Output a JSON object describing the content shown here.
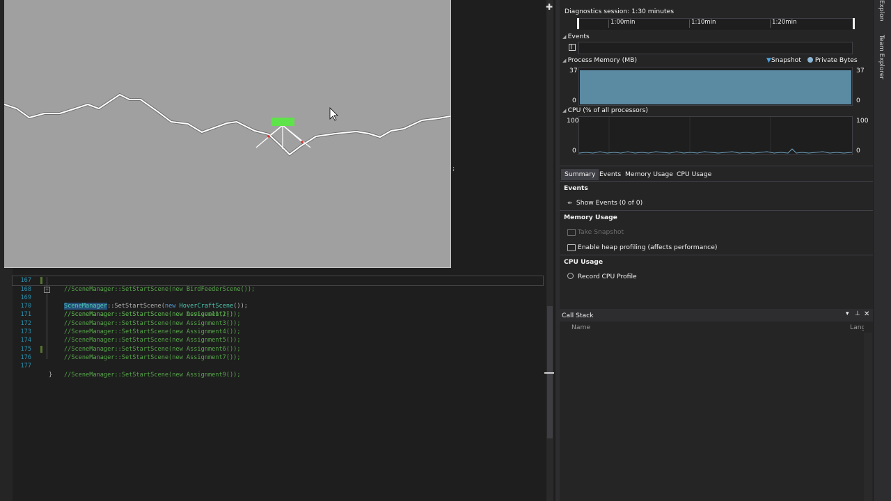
{
  "editor": {
    "lines": [
      {
        "num": "167",
        "text": "//SceneManager::SetStartScene(new BirdFeederScene());"
      },
      {
        "num": "168",
        "sel": "SceneManager",
        "mid": "::SetStartScene(",
        "kw": "new",
        "type": "HoverCraftScene",
        "tail": "());"
      },
      {
        "num": "169",
        "text": "//SceneManager::SetStartScene(new DevLevel1());"
      },
      {
        "num": "170",
        "text": "//SceneManager::SetStartScene(new Assignment2());"
      },
      {
        "num": "171",
        "text": "//SceneManager::SetStartScene(new Assignment3());"
      },
      {
        "num": "172",
        "text": "//SceneManager::SetStartScene(new Assignment4());"
      },
      {
        "num": "173",
        "text": "//SceneManager::SetStartScene(new Assignment5());"
      },
      {
        "num": "174",
        "text": "//SceneManager::SetStartScene(new Assignment6());"
      },
      {
        "num": "175",
        "text": "//SceneManager::SetStartScene(new Assignment7());"
      },
      {
        "num": "176",
        "text": "//SceneManager::SetStartScene(new Assignment9());"
      },
      {
        "num": "177",
        "text": "}"
      }
    ],
    "stray_glyph": ";"
  },
  "game": {
    "background": "#a0a0a0",
    "terrain_color": "#ffffff",
    "craft_color": "#5fe34a"
  },
  "diagnostics": {
    "session_label": "Diagnostics session: 1:30 minutes",
    "timeline_ticks": [
      "1:00min",
      "1:10min",
      "1:20min"
    ],
    "events_header": "Events",
    "memory_header": "Process Memory (MB)",
    "legend_snapshot": "Snapshot",
    "legend_private": "Private Bytes",
    "memory_max": "37",
    "memory_min": "0",
    "memory_max_right": "37",
    "memory_min_right": "0",
    "memory_fill_color": "#5b8aa3",
    "cpu_header": "CPU (% of all processors)",
    "cpu_max": "100",
    "cpu_min": "0",
    "cpu_max_right": "100",
    "cpu_min_right": "0",
    "tabs": [
      "Summary",
      "Events",
      "Memory Usage",
      "CPU Usage"
    ],
    "summary": {
      "events_title": "Events",
      "show_events": "Show Events (0 of 0)",
      "memory_title": "Memory Usage",
      "take_snapshot": "Take Snapshot",
      "enable_heap": "Enable heap profiling (affects performance)",
      "cpu_title": "CPU Usage",
      "record_cpu": "Record CPU Profile"
    }
  },
  "callstack": {
    "title": "Call Stack",
    "col_name": "Name",
    "col_lang": "Lang"
  },
  "rail": {
    "explorer_partial": "Explorer",
    "team_explorer": "Team Explorer"
  }
}
